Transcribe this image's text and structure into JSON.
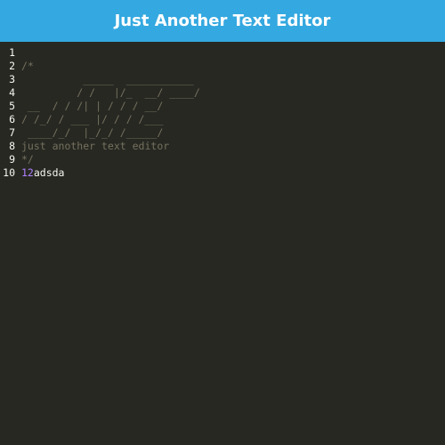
{
  "window": {
    "title": "Just Another Text Editor"
  },
  "editor": {
    "lines": [
      {
        "no": "1",
        "segments": [
          {
            "text": "",
            "kind": "plain"
          }
        ]
      },
      {
        "no": "2",
        "segments": [
          {
            "text": "/*",
            "kind": "comment"
          }
        ]
      },
      {
        "no": "3",
        "segments": [
          {
            "text": "          _____  ___________",
            "kind": "comment"
          }
        ]
      },
      {
        "no": "4",
        "segments": [
          {
            "text": "         / /   |/_  __/ ____/",
            "kind": "comment"
          }
        ]
      },
      {
        "no": "5",
        "segments": [
          {
            "text": " __  / / /| | / / / __/",
            "kind": "comment"
          }
        ]
      },
      {
        "no": "6",
        "segments": [
          {
            "text": "/ /_/ / ___ |/ / / /___",
            "kind": "comment"
          }
        ]
      },
      {
        "no": "7",
        "segments": [
          {
            "text": " ____/_/  |_/_/ /_____/",
            "kind": "comment"
          }
        ]
      },
      {
        "no": "8",
        "segments": [
          {
            "text": "just another text editor",
            "kind": "comment"
          }
        ]
      },
      {
        "no": "9",
        "segments": [
          {
            "text": "*/",
            "kind": "comment"
          }
        ]
      },
      {
        "no": "10",
        "segments": [
          {
            "text": "12",
            "kind": "num"
          },
          {
            "text": "adsda",
            "kind": "plain"
          }
        ]
      }
    ]
  },
  "colors": {
    "header_bg": "#34a8e0",
    "editor_bg": "#272822",
    "comment": "#75715e",
    "number": "#ae81ff",
    "text": "#f8f8f2"
  }
}
